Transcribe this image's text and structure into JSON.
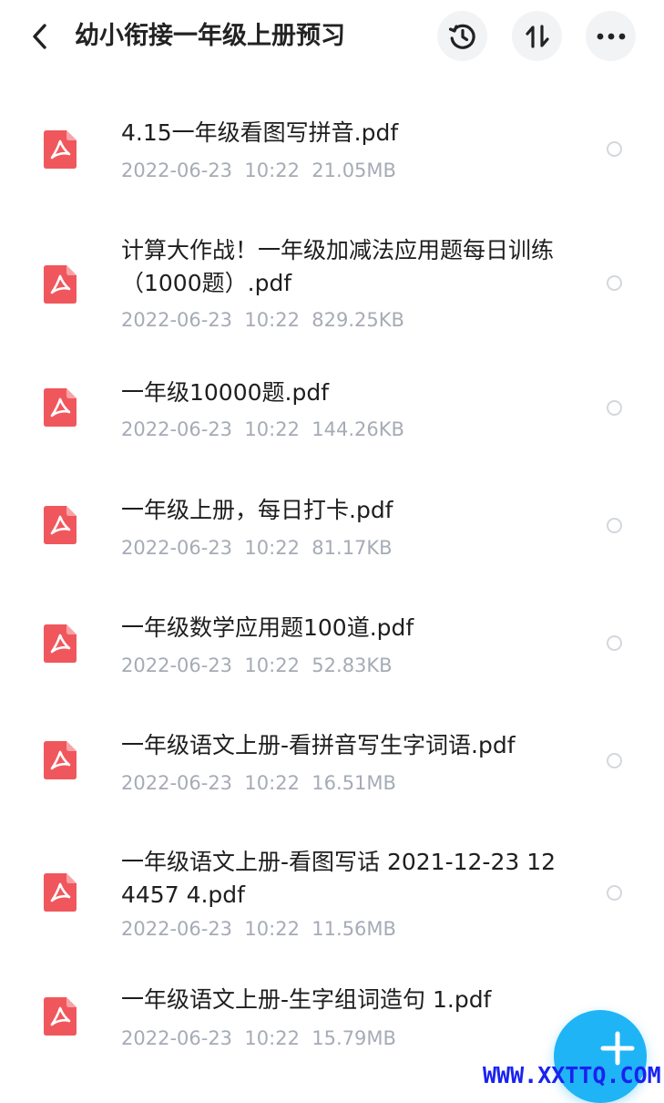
{
  "header": {
    "title": "幼小衔接一年级上册预习",
    "back_icon": "chevron-left-icon",
    "history_icon": "history-icon",
    "sort_icon": "sort-icon",
    "more_icon": "more-horizontal-icon"
  },
  "files": [
    {
      "name": "4.15一年级看图写拼音.pdf",
      "date": "2022-06-23",
      "time": "10:22",
      "size": "21.05MB",
      "icon": "pdf-icon"
    },
    {
      "name": "计算大作战！一年级加减法应用题每日训练（1000题）.pdf",
      "date": "2022-06-23",
      "time": "10:22",
      "size": "829.25KB",
      "icon": "pdf-icon"
    },
    {
      "name": "一年级10000题.pdf",
      "date": "2022-06-23",
      "time": "10:22",
      "size": "144.26KB",
      "icon": "pdf-icon"
    },
    {
      "name": "一年级上册，每日打卡.pdf",
      "date": "2022-06-23",
      "time": "10:22",
      "size": "81.17KB",
      "icon": "pdf-icon"
    },
    {
      "name": "一年级数学应用题100道.pdf",
      "date": "2022-06-23",
      "time": "10:22",
      "size": "52.83KB",
      "icon": "pdf-icon"
    },
    {
      "name": "一年级语文上册-看拼音写生字词语.pdf",
      "date": "2022-06-23",
      "time": "10:22",
      "size": "16.51MB",
      "icon": "pdf-icon"
    },
    {
      "name": "一年级语文上册-看图写话 2021-12-23 124457 4.pdf",
      "date": "2022-06-23",
      "time": "10:22",
      "size": "11.56MB",
      "icon": "pdf-icon"
    },
    {
      "name": "一年级语文上册-生字组词造句 1.pdf",
      "date": "2022-06-23",
      "time": "10:22",
      "size": "15.79MB",
      "icon": "pdf-icon"
    }
  ],
  "fab": {
    "icon": "plus-icon"
  },
  "watermark": "WWW.XXTTQ.COM",
  "colors": {
    "pdf_red": "#f0575d",
    "accent_blue": "#1fb4f5",
    "meta_gray": "#a6abb5",
    "watermark_blue": "#1a22f0"
  }
}
